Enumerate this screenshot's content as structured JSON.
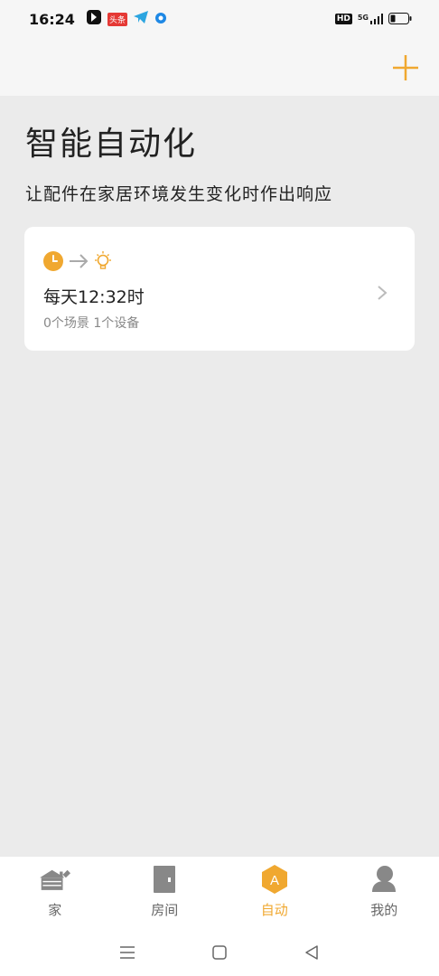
{
  "status_bar": {
    "time": "16:24",
    "notif_badge": "头条",
    "hd": "HD",
    "net": "5G"
  },
  "page": {
    "title": "智能自动化",
    "subtitle": "让配件在家居环境发生变化时作出响应"
  },
  "automation": {
    "title": "每天12:32时",
    "subtitle": "0个场景 1个设备"
  },
  "tabs": [
    {
      "label": "家",
      "icon": "home-icon"
    },
    {
      "label": "房间",
      "icon": "door-icon"
    },
    {
      "label": "自动",
      "icon": "automation-icon",
      "icon_letter": "A"
    },
    {
      "label": "我的",
      "icon": "profile-icon"
    }
  ],
  "colors": {
    "accent": "#f0a830",
    "background": "#ebebeb",
    "card": "#ffffff"
  }
}
